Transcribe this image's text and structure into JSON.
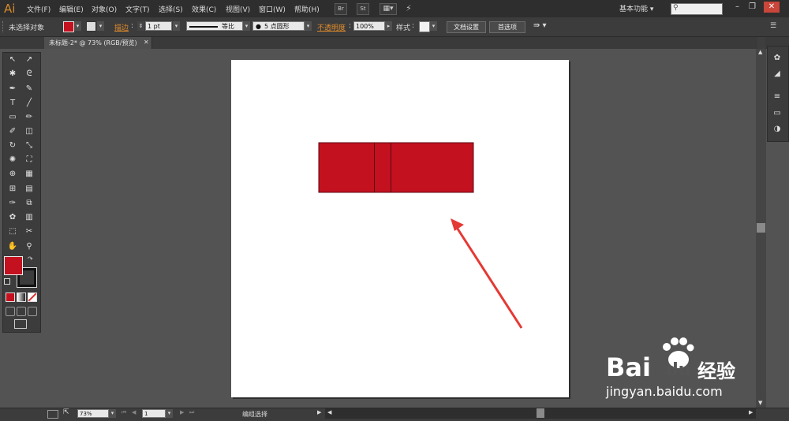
{
  "app": {
    "logo": "Ai"
  },
  "menubar": {
    "items": [
      "文件(F)",
      "编辑(E)",
      "对象(O)",
      "文字(T)",
      "选择(S)",
      "效果(C)",
      "视图(V)",
      "窗口(W)",
      "帮助(H)"
    ],
    "br_label": "Br",
    "st_label": "St",
    "workspace": "基本功能",
    "window_controls": [
      "minimize-icon",
      "restore-icon",
      "close-icon"
    ]
  },
  "control_bar": {
    "selection_status": "未选择对象",
    "fill_color": "#c4111f",
    "stroke_label": "描边",
    "stroke_weight": "1 pt",
    "stroke_profile": "等比",
    "brush_definition": "5 点圆形",
    "opacity_label": "不透明度",
    "opacity_value": "100%",
    "style_label": "样式",
    "doc_setup_button": "文档设置",
    "preferences_button": "首选项"
  },
  "document": {
    "tab_title": "未标题-2* @ 73% (RGB/预览)"
  },
  "canvas": {
    "shape_color": "#c4111f",
    "arrow_color": "#e53935",
    "artboard_color": "#ffffff"
  },
  "tools": [
    "selection-tool",
    "direct-selection-tool",
    "magic-wand-tool",
    "lasso-tool",
    "pen-tool",
    "curvature-tool",
    "type-tool",
    "line-tool",
    "rectangle-tool",
    "paintbrush-tool",
    "pencil-tool",
    "eraser-tool",
    "rotate-tool",
    "scale-tool",
    "warp-tool",
    "free-transform-tool",
    "shape-builder-tool",
    "perspective-grid-tool",
    "mesh-tool",
    "gradient-tool",
    "eyedropper-tool",
    "blend-tool",
    "symbol-sprayer-tool",
    "column-graph-tool",
    "artboard-tool",
    "slice-tool",
    "hand-tool",
    "zoom-tool"
  ],
  "tool_glyphs": [
    "↖",
    "↗",
    "✱",
    "ᘓ",
    "✒",
    "✎",
    "T",
    "╱",
    "▭",
    "✏",
    "✐",
    "◫",
    "↻",
    "⤡",
    "✺",
    "⛶",
    "⊕",
    "▦",
    "⊞",
    "▤",
    "✑",
    "⧉",
    "✿",
    "▥",
    "⬚",
    "✂",
    "✋",
    "⚲"
  ],
  "status_bar": {
    "zoom": "73%",
    "page": "1",
    "mode": "编组选择"
  },
  "watermark": {
    "brand": "Bai",
    "brand_suffix": "经验",
    "url": "jingyan.baidu.com"
  }
}
